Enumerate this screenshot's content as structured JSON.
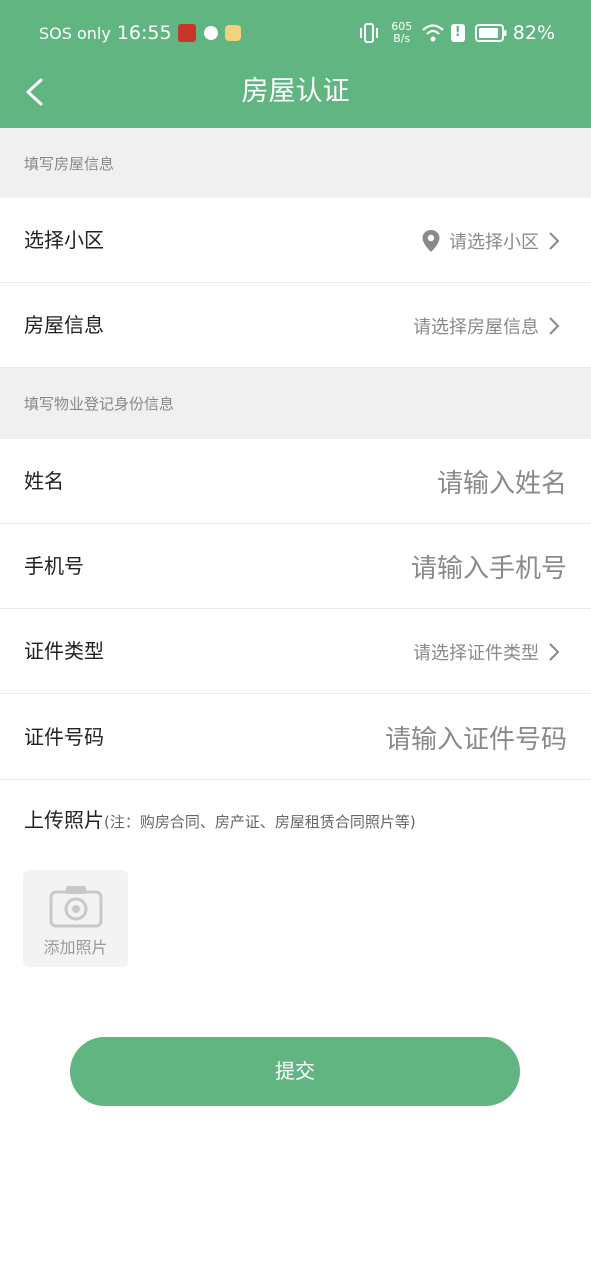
{
  "status_bar": {
    "carrier": "SOS only",
    "time": "16:55",
    "net_speed_value": "605",
    "net_speed_unit": "B/s",
    "alert_glyph": "!",
    "battery": "82%",
    "icons": [
      "app-red-icon",
      "shield-x-icon",
      "bird-icon",
      "vibrate-icon",
      "wifi-icon",
      "alert-icon",
      "battery-icon"
    ]
  },
  "header": {
    "title": "房屋认证",
    "back_icon": "chevron-left-icon"
  },
  "section1": {
    "title": "填写房屋信息"
  },
  "community": {
    "label": "选择小区",
    "placeholder": "请选择小区",
    "icon": "location-pin-icon"
  },
  "house_info": {
    "label": "房屋信息",
    "placeholder": "请选择房屋信息"
  },
  "section2": {
    "title": "填写物业登记身份信息"
  },
  "name": {
    "label": "姓名",
    "placeholder": "请输入姓名"
  },
  "phone": {
    "label": "手机号",
    "placeholder": "请输入手机号"
  },
  "id_type": {
    "label": "证件类型",
    "placeholder": "请选择证件类型"
  },
  "id_number": {
    "label": "证件号码",
    "placeholder": "请输入证件号码"
  },
  "upload": {
    "title": "上传照片",
    "note": "(注：购房合同、房产证、房屋租赁合同照片等)",
    "add_label": "添加照片",
    "icon": "camera-icon"
  },
  "submit_label": "提交",
  "colors": {
    "accent": "#60b580",
    "section_bg": "#f0f0f0",
    "placeholder": "#8a8a8a"
  }
}
